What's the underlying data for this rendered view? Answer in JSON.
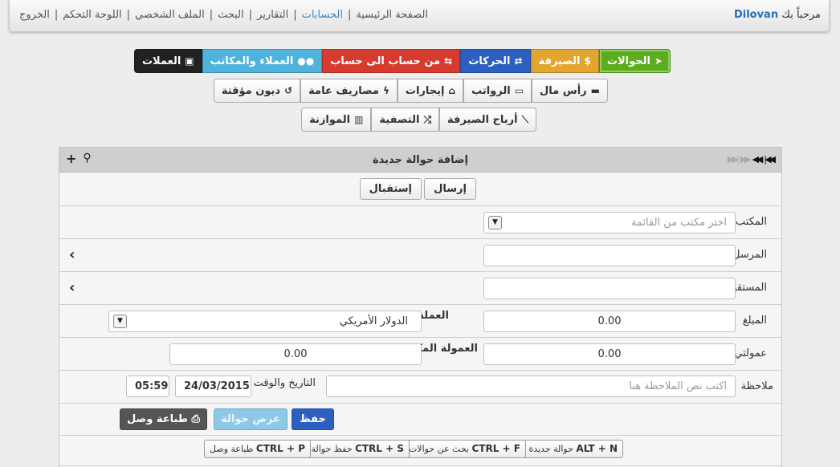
{
  "header": {
    "welcome": "مرحباً بك",
    "username": "Dilovan",
    "links": [
      {
        "label": "الصفحة الرئيسية",
        "active": false
      },
      {
        "label": "الحسابات",
        "active": true
      },
      {
        "label": "التقارير",
        "active": false
      },
      {
        "label": "البحث",
        "active": false
      },
      {
        "label": "الملف الشخصي",
        "active": false
      },
      {
        "label": "اللوحة التحكم",
        "active": false
      },
      {
        "label": "الخروج",
        "active": false
      }
    ]
  },
  "toolbar_row1": [
    {
      "label": "الحوالات",
      "icon": "rocket-icon",
      "glyph": "🚀"
    },
    {
      "label": "الصيرفة",
      "icon": "dollar-icon",
      "glyph": "$"
    },
    {
      "label": "الحركات",
      "icon": "exchange-icon",
      "glyph": "⇄"
    },
    {
      "label": "من حساب الى حساب",
      "icon": "retweet-icon",
      "glyph": "⇆"
    },
    {
      "label": "العملاء والمكاتب",
      "icon": "users-icon",
      "glyph": "👥"
    },
    {
      "label": "العملات",
      "icon": "money-icon",
      "glyph": "💵"
    }
  ],
  "toolbar_row2": [
    {
      "label": "رأس مال",
      "icon": "briefcase-icon",
      "glyph": "💼"
    },
    {
      "label": "الرواتب",
      "icon": "calendar-icon",
      "glyph": "📅"
    },
    {
      "label": "إيجارات",
      "icon": "home-icon",
      "glyph": "⌂"
    },
    {
      "label": "مصاريف عامة",
      "icon": "bolt-icon",
      "glyph": "ϟ"
    },
    {
      "label": "ديون مؤقتة",
      "icon": "history-icon",
      "glyph": "↺"
    }
  ],
  "toolbar_row3": [
    {
      "label": "أرباح الصيرفة",
      "icon": "line-chart-icon",
      "glyph": "📈"
    },
    {
      "label": "التصفية",
      "icon": "random-icon",
      "glyph": "⤮"
    },
    {
      "label": "الموازنة",
      "icon": "bar-chart-icon",
      "glyph": "📊"
    }
  ],
  "panel": {
    "title": "إضافة حوالة جديدة",
    "send_label": "إرسال",
    "receive_label": "إستقبال",
    "office_label": "المكتب",
    "office_placeholder": "اختر مكتب من القائمة",
    "sender_label": "المرسل",
    "sender_value": "",
    "receiver_label": "المستقبل",
    "receiver_value": "",
    "amount_label": "المبلغ",
    "amount_value": "0.00",
    "currency_label": "العملة",
    "currency_value": "الدولار الأمريكي",
    "commission_label": "عمولتي",
    "commission_value": "0.00",
    "office_commission_label": "العمولة المكتب",
    "office_commission_value": "0.00",
    "note_label": "ملاحظة",
    "note_placeholder": "اكتب نص الملاحظة هنا",
    "datetime_label": "التاريخ والوقت",
    "date_value": "24/03/2015",
    "time_value": "05:59",
    "save_label": "حفظ",
    "view_label": "عرض حوالة",
    "print_label": "طباعة وصل"
  },
  "shortcuts": [
    {
      "keys": "ALT + N",
      "desc": "حوالة جديدة"
    },
    {
      "keys": "CTRL + F",
      "desc": "بحث عن حوالات"
    },
    {
      "keys": "CTRL + S",
      "desc": "حفظ حوالة"
    },
    {
      "keys": "CTRL + P",
      "desc": "طباعة وصل"
    }
  ],
  "colors": {
    "accent_green": "#5cac1f",
    "accent_orange": "#e2a530",
    "accent_blue": "#2c5fbf",
    "accent_red": "#d63b2f",
    "accent_cyan": "#4fb3dc",
    "link_active": "#3a87c8"
  }
}
